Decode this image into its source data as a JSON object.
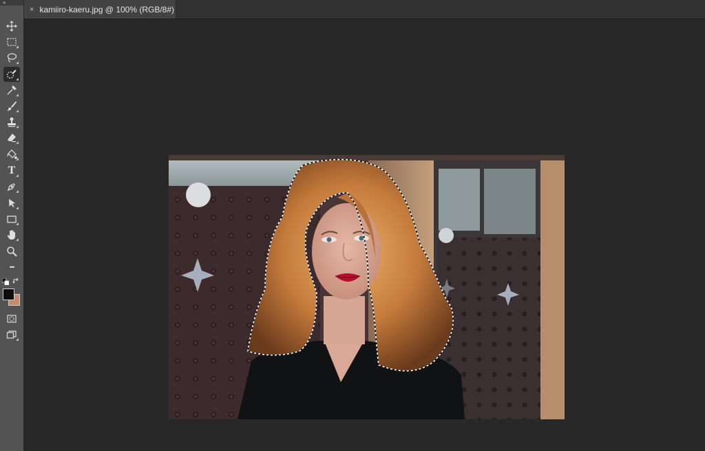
{
  "document": {
    "tab_title": "kamiiro-kaeru.jpg @ 100% (RGB/8#)",
    "close_symbol": "×"
  },
  "toolbar": {
    "collapse_symbol": "»",
    "tools": [
      {
        "name": "move-tool",
        "icon": "move-icon",
        "active": false
      },
      {
        "name": "marquee-tool",
        "icon": "rectangular-marquee-icon",
        "active": false
      },
      {
        "name": "lasso-tool",
        "icon": "lasso-icon",
        "active": false
      },
      {
        "name": "quick-selection-tool",
        "icon": "quick-selection-brush-icon",
        "active": true
      },
      {
        "name": "eyedropper-tool",
        "icon": "eyedropper-icon",
        "active": false
      },
      {
        "name": "brush-tool",
        "icon": "brush-icon",
        "active": false
      },
      {
        "name": "clone-stamp-tool",
        "icon": "stamp-icon",
        "active": false
      },
      {
        "name": "eraser-tool",
        "icon": "eraser-icon",
        "active": false
      },
      {
        "name": "paint-bucket-tool",
        "icon": "paint-bucket-icon",
        "active": false
      },
      {
        "name": "type-tool",
        "icon": "type-icon",
        "label": "T",
        "active": false
      },
      {
        "name": "pen-tool",
        "icon": "pen-icon",
        "active": false
      },
      {
        "name": "path-selection-tool",
        "icon": "arrow-pointer-icon",
        "active": false
      },
      {
        "name": "rectangle-tool",
        "icon": "rectangle-icon",
        "active": false
      },
      {
        "name": "hand-tool",
        "icon": "hand-icon",
        "active": false
      },
      {
        "name": "zoom-tool",
        "icon": "magnifier-icon",
        "active": false
      },
      {
        "name": "more-tools",
        "icon": "ellipsis-icon",
        "label": "•••",
        "active": false
      }
    ]
  },
  "colors": {
    "foreground": "#0c0c0c",
    "background": "#c78a6c",
    "canvas_bg": "#282828",
    "toolbar_bg": "#535353"
  },
  "image": {
    "subject": "woman-with-curly-red-hair",
    "selection": "marching-ants-around-hair"
  }
}
